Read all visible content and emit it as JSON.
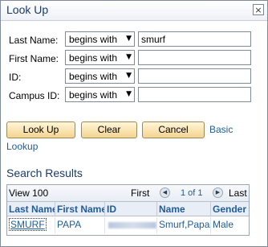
{
  "window": {
    "title": "Look Up",
    "close_glyph": "×"
  },
  "criteria": [
    {
      "label": "Last Name:",
      "operator": "begins with",
      "value": "smurf"
    },
    {
      "label": "First Name:",
      "operator": "begins with",
      "value": ""
    },
    {
      "label": "ID:",
      "operator": "begins with",
      "value": ""
    },
    {
      "label": "Campus ID:",
      "operator": "begins with",
      "value": ""
    }
  ],
  "buttons": {
    "lookup": "Look Up",
    "clear": "Clear",
    "cancel": "Cancel",
    "basic_lookup": "Basic",
    "basic_lookup_2": "Lookup"
  },
  "results": {
    "title": "Search Results",
    "view_all": "View 100",
    "first": "First",
    "page_info": "1 of 1",
    "last": "Last",
    "columns": [
      "Last Name",
      "First Name",
      "ID",
      "Name",
      "Gender"
    ],
    "rows": [
      {
        "last_name": "SMURF",
        "first_name": "PAPA",
        "id": "",
        "name": "Smurf,Papa",
        "gender": "Male"
      }
    ]
  },
  "icons": {
    "prev": "prev-arrow-icon",
    "next": "next-arrow-icon",
    "dropdown": "chevron-down-icon"
  },
  "colors": {
    "title": "#1a3a6a",
    "link": "#1f5c99",
    "button_gradient_top": "#fff6d9",
    "button_gradient_bottom": "#f4d48f"
  }
}
